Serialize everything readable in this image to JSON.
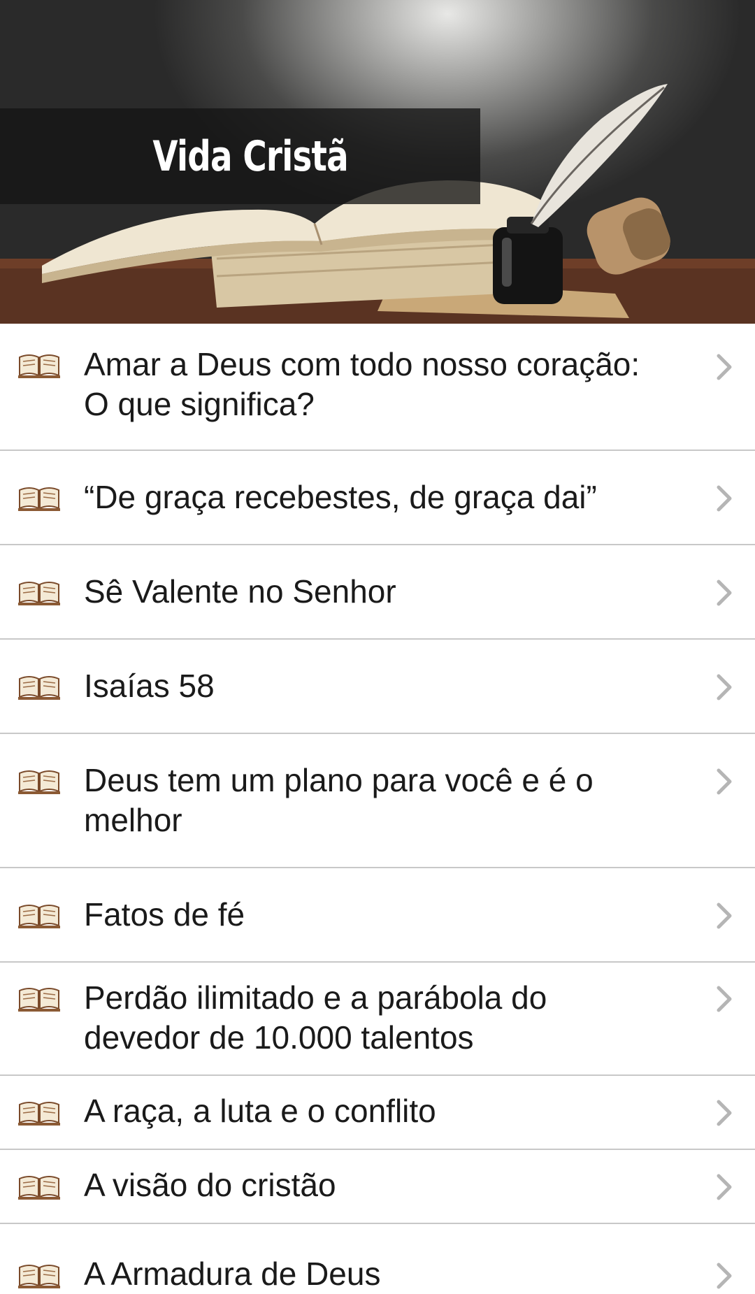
{
  "header": {
    "title": "Vida Cristã"
  },
  "icons": {
    "item": "open-book-icon",
    "arrow": "chevron-right-icon"
  },
  "items": [
    {
      "label": "Amar a Deus com todo nosso coração: O que significa?"
    },
    {
      "label": "“De graça recebestes, de graça dai”"
    },
    {
      "label": "Sê Valente no Senhor"
    },
    {
      "label": "Isaías 58"
    },
    {
      "label": "Deus tem um plano para você e é o melhor"
    },
    {
      "label": "Fatos de fé"
    },
    {
      "label": "Perdão ilimitado e a parábola do devedor de 10.000 talentos"
    },
    {
      "label": "A raça, a luta e o conflito"
    },
    {
      "label": "A visão do cristão"
    },
    {
      "label": "A Armadura de Deus"
    }
  ]
}
